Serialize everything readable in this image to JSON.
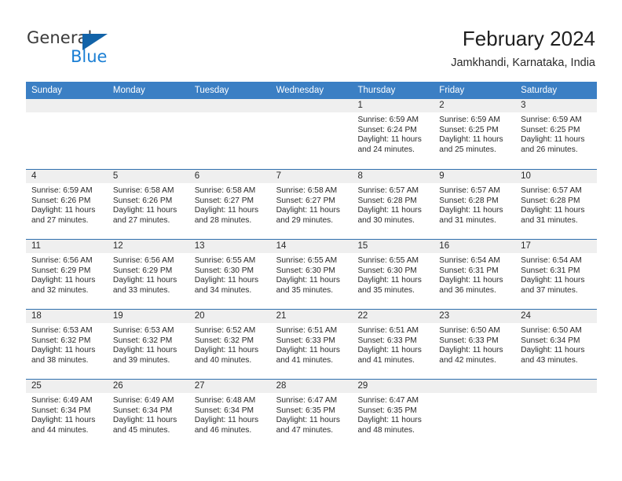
{
  "logo": {
    "word1": "General",
    "word2": "Blue",
    "triangle_color": "#1263a8",
    "blue_color": "#1b7fd4"
  },
  "header": {
    "title": "February 2024",
    "subtitle": "Jamkhandi, Karnataka, India"
  },
  "theme": {
    "header_blue": "#3b7fc4",
    "row_divider": "#2f6fae",
    "date_strip": "#efefef"
  },
  "calendar": {
    "weekdays": [
      "Sunday",
      "Monday",
      "Tuesday",
      "Wednesday",
      "Thursday",
      "Friday",
      "Saturday"
    ],
    "weeks": [
      [
        {
          "date": "",
          "lines": []
        },
        {
          "date": "",
          "lines": []
        },
        {
          "date": "",
          "lines": []
        },
        {
          "date": "",
          "lines": []
        },
        {
          "date": "1",
          "lines": [
            "Sunrise: 6:59 AM",
            "Sunset: 6:24 PM",
            "Daylight: 11 hours",
            "and 24 minutes."
          ]
        },
        {
          "date": "2",
          "lines": [
            "Sunrise: 6:59 AM",
            "Sunset: 6:25 PM",
            "Daylight: 11 hours",
            "and 25 minutes."
          ]
        },
        {
          "date": "3",
          "lines": [
            "Sunrise: 6:59 AM",
            "Sunset: 6:25 PM",
            "Daylight: 11 hours",
            "and 26 minutes."
          ]
        }
      ],
      [
        {
          "date": "4",
          "lines": [
            "Sunrise: 6:59 AM",
            "Sunset: 6:26 PM",
            "Daylight: 11 hours",
            "and 27 minutes."
          ]
        },
        {
          "date": "5",
          "lines": [
            "Sunrise: 6:58 AM",
            "Sunset: 6:26 PM",
            "Daylight: 11 hours",
            "and 27 minutes."
          ]
        },
        {
          "date": "6",
          "lines": [
            "Sunrise: 6:58 AM",
            "Sunset: 6:27 PM",
            "Daylight: 11 hours",
            "and 28 minutes."
          ]
        },
        {
          "date": "7",
          "lines": [
            "Sunrise: 6:58 AM",
            "Sunset: 6:27 PM",
            "Daylight: 11 hours",
            "and 29 minutes."
          ]
        },
        {
          "date": "8",
          "lines": [
            "Sunrise: 6:57 AM",
            "Sunset: 6:28 PM",
            "Daylight: 11 hours",
            "and 30 minutes."
          ]
        },
        {
          "date": "9",
          "lines": [
            "Sunrise: 6:57 AM",
            "Sunset: 6:28 PM",
            "Daylight: 11 hours",
            "and 31 minutes."
          ]
        },
        {
          "date": "10",
          "lines": [
            "Sunrise: 6:57 AM",
            "Sunset: 6:28 PM",
            "Daylight: 11 hours",
            "and 31 minutes."
          ]
        }
      ],
      [
        {
          "date": "11",
          "lines": [
            "Sunrise: 6:56 AM",
            "Sunset: 6:29 PM",
            "Daylight: 11 hours",
            "and 32 minutes."
          ]
        },
        {
          "date": "12",
          "lines": [
            "Sunrise: 6:56 AM",
            "Sunset: 6:29 PM",
            "Daylight: 11 hours",
            "and 33 minutes."
          ]
        },
        {
          "date": "13",
          "lines": [
            "Sunrise: 6:55 AM",
            "Sunset: 6:30 PM",
            "Daylight: 11 hours",
            "and 34 minutes."
          ]
        },
        {
          "date": "14",
          "lines": [
            "Sunrise: 6:55 AM",
            "Sunset: 6:30 PM",
            "Daylight: 11 hours",
            "and 35 minutes."
          ]
        },
        {
          "date": "15",
          "lines": [
            "Sunrise: 6:55 AM",
            "Sunset: 6:30 PM",
            "Daylight: 11 hours",
            "and 35 minutes."
          ]
        },
        {
          "date": "16",
          "lines": [
            "Sunrise: 6:54 AM",
            "Sunset: 6:31 PM",
            "Daylight: 11 hours",
            "and 36 minutes."
          ]
        },
        {
          "date": "17",
          "lines": [
            "Sunrise: 6:54 AM",
            "Sunset: 6:31 PM",
            "Daylight: 11 hours",
            "and 37 minutes."
          ]
        }
      ],
      [
        {
          "date": "18",
          "lines": [
            "Sunrise: 6:53 AM",
            "Sunset: 6:32 PM",
            "Daylight: 11 hours",
            "and 38 minutes."
          ]
        },
        {
          "date": "19",
          "lines": [
            "Sunrise: 6:53 AM",
            "Sunset: 6:32 PM",
            "Daylight: 11 hours",
            "and 39 minutes."
          ]
        },
        {
          "date": "20",
          "lines": [
            "Sunrise: 6:52 AM",
            "Sunset: 6:32 PM",
            "Daylight: 11 hours",
            "and 40 minutes."
          ]
        },
        {
          "date": "21",
          "lines": [
            "Sunrise: 6:51 AM",
            "Sunset: 6:33 PM",
            "Daylight: 11 hours",
            "and 41 minutes."
          ]
        },
        {
          "date": "22",
          "lines": [
            "Sunrise: 6:51 AM",
            "Sunset: 6:33 PM",
            "Daylight: 11 hours",
            "and 41 minutes."
          ]
        },
        {
          "date": "23",
          "lines": [
            "Sunrise: 6:50 AM",
            "Sunset: 6:33 PM",
            "Daylight: 11 hours",
            "and 42 minutes."
          ]
        },
        {
          "date": "24",
          "lines": [
            "Sunrise: 6:50 AM",
            "Sunset: 6:34 PM",
            "Daylight: 11 hours",
            "and 43 minutes."
          ]
        }
      ],
      [
        {
          "date": "25",
          "lines": [
            "Sunrise: 6:49 AM",
            "Sunset: 6:34 PM",
            "Daylight: 11 hours",
            "and 44 minutes."
          ]
        },
        {
          "date": "26",
          "lines": [
            "Sunrise: 6:49 AM",
            "Sunset: 6:34 PM",
            "Daylight: 11 hours",
            "and 45 minutes."
          ]
        },
        {
          "date": "27",
          "lines": [
            "Sunrise: 6:48 AM",
            "Sunset: 6:34 PM",
            "Daylight: 11 hours",
            "and 46 minutes."
          ]
        },
        {
          "date": "28",
          "lines": [
            "Sunrise: 6:47 AM",
            "Sunset: 6:35 PM",
            "Daylight: 11 hours",
            "and 47 minutes."
          ]
        },
        {
          "date": "29",
          "lines": [
            "Sunrise: 6:47 AM",
            "Sunset: 6:35 PM",
            "Daylight: 11 hours",
            "and 48 minutes."
          ]
        },
        {
          "date": "",
          "lines": []
        },
        {
          "date": "",
          "lines": []
        }
      ]
    ]
  }
}
